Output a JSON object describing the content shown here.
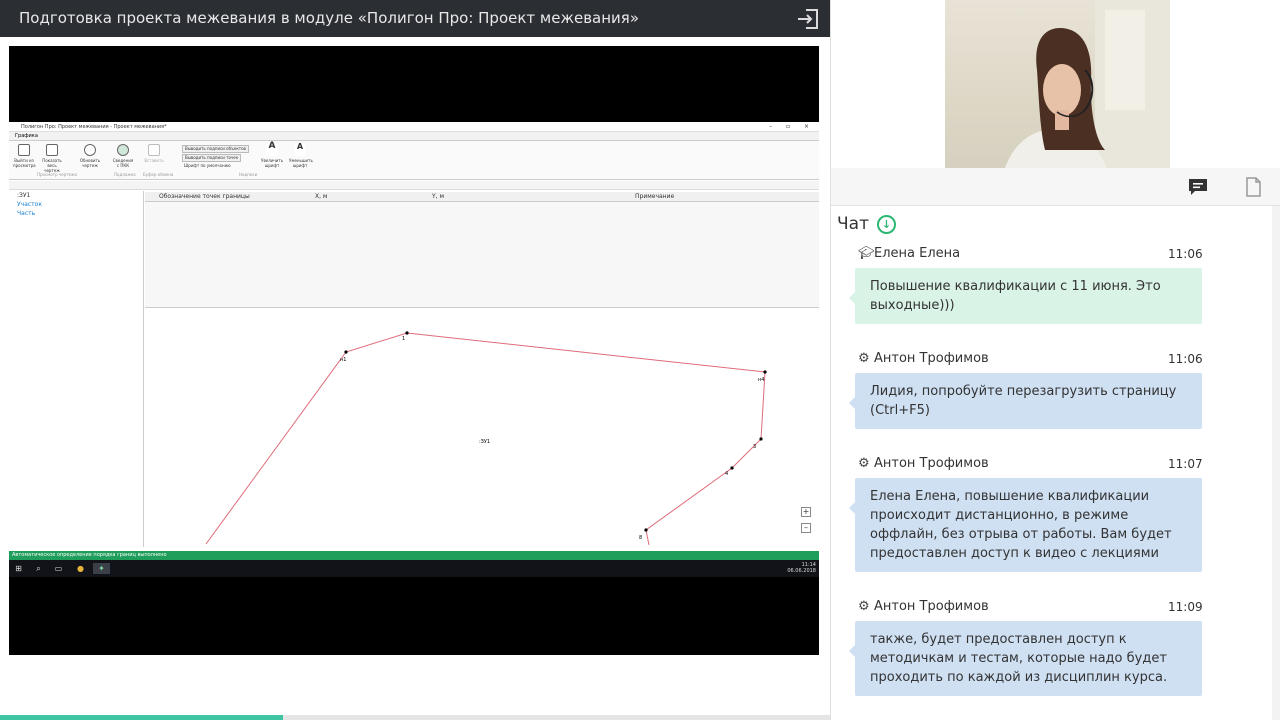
{
  "header": {
    "title": "Подготовка проекта межевания в модуле «Полигон Про: Проект межевания»"
  },
  "video": {
    "app_title": "Полигон Про: Проект межевания - Проект межевания*",
    "ribbon_tab": "Графика",
    "ribbon_buttons": [
      {
        "label": "Выйти из просмотра"
      },
      {
        "label": "Показать весь чертеж"
      },
      {
        "label": "Обновить чертеж"
      },
      {
        "label": "Сведения с ПКК"
      },
      {
        "label": "Вставить"
      },
      {
        "label": "Увеличить шрифт"
      },
      {
        "label": "Уменьшить шрифт"
      }
    ],
    "ribbon_checks": [
      "Выводить подписи объектов",
      "Выводить подписи точек",
      "Шрифт по умолчанию"
    ],
    "ribbon_groups": [
      "Просмотр чертежа",
      "Подложка",
      "Буфер обмена",
      "Надписи"
    ],
    "tree_items": [
      ":ЗУ1",
      "Участок",
      "Часть"
    ],
    "grid_columns": [
      "Обозначение точек границы",
      "X, м",
      "Y, м",
      "Примечание"
    ],
    "point_labels": [
      "н1",
      "1",
      "н4",
      "3",
      "4",
      "8"
    ],
    "parcel_label": ":ЗУ1",
    "status_text": "Автоматическое определение порядка границ выполнено",
    "clock_time": "11:14",
    "clock_date": "06.06.2018"
  },
  "progress": {
    "fraction": 0.34
  },
  "chat": {
    "title": "Чат",
    "messages": [
      {
        "author": "Елена Елена",
        "role_icon": "graduation-cap-icon",
        "time": "11:06",
        "text": "Повышение квалификации с 11 июня. Это выходные)))",
        "style": "green"
      },
      {
        "author": "Антон Трофимов",
        "role_icon": "gear-icon",
        "time": "11:06",
        "text": "Лидия, попробуйте перезагрузить страницу (Ctrl+F5)",
        "style": "blue"
      },
      {
        "author": "Антон Трофимов",
        "role_icon": "gear-icon",
        "time": "11:07",
        "text": "Елена Елена, повышение квалификации происходит дистанционно, в режиме оффлайн, без отрыва от работы. Вам будет предоставлен доступ к видео с лекциями",
        "style": "blue"
      },
      {
        "author": "Антон Трофимов",
        "role_icon": "gear-icon",
        "time": "11:09",
        "text": "также, будет предоставлен доступ к методичкам и тестам, которые надо будет проходить по каждой из дисциплин курса.",
        "style": "blue"
      }
    ]
  },
  "colors": {
    "accent_green": "#2bb673",
    "bubble_green": "#d9f3e7",
    "bubble_blue": "#cfe0f3",
    "topbar": "#2b2e33"
  }
}
